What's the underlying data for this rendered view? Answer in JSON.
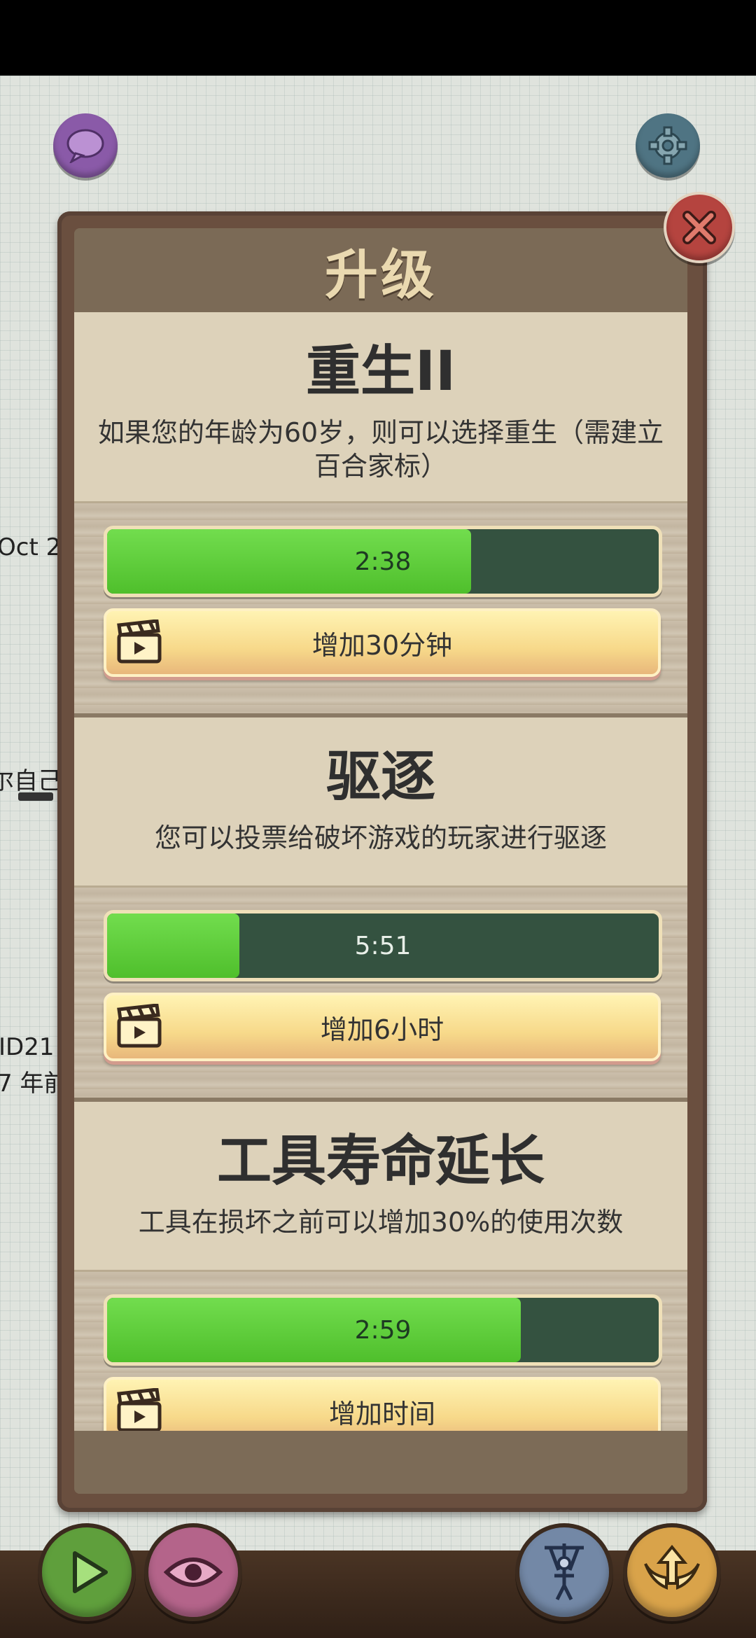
{
  "dialog": {
    "title": "升级"
  },
  "background": {
    "t1": "Oct 2",
    "t2": "尔自己",
    "t3": "ID21",
    "t4": "7 年前"
  },
  "upgrades": [
    {
      "title": "重生II",
      "description": "如果您的年龄为60岁，则可以选择重生（需建立百合家标）",
      "timer": "2:38",
      "progress": 0.66,
      "button_label": "增加30分钟"
    },
    {
      "title": "驱逐",
      "description": "您可以投票给破坏游戏的玩家进行驱逐",
      "timer": "5:51",
      "progress": 0.24,
      "button_label": "增加6小时"
    },
    {
      "title": "工具寿命延长",
      "description": "工具在损坏之前可以增加30%的使用次数",
      "timer": "2:59",
      "progress": 0.75,
      "button_label": "增加时间"
    }
  ],
  "icons": {
    "chat": "chat-bubble-icon",
    "settings": "gear-icon",
    "close": "close-icon",
    "play": "play-icon",
    "watch": "eye-icon",
    "puppet": "puppet-icon",
    "upgrade": "winged-arrow-icon",
    "ad": "clapperboard-icon"
  },
  "colors": {
    "bar_fill": "#5cc83a",
    "bar_track": "#345240",
    "title_text": "#ead9b0"
  }
}
